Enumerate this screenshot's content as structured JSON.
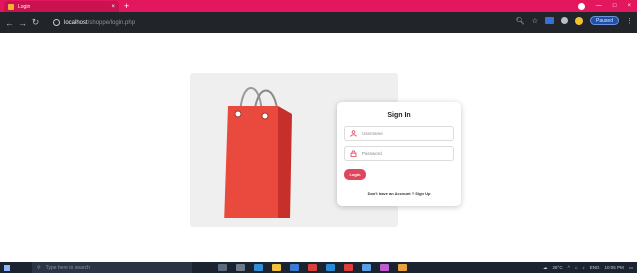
{
  "browser": {
    "tab_title": "Login",
    "tab_close": "×",
    "new_tab": "+",
    "url_host": "localhost",
    "url_path": "/shoppe/login.php",
    "profile_label": "Paused",
    "window_buttons": [
      "—",
      "□",
      "×"
    ]
  },
  "form": {
    "title": "Sign In",
    "username_placeholder": "Username",
    "password_placeholder": "Password",
    "login_button": "Login",
    "signup_prompt": "Don't have an Account ?",
    "signup_link": "Sign Up"
  },
  "taskbar": {
    "search_placeholder": "Type here to search",
    "weather": "26°C",
    "lang": "ENG",
    "time": "10:05 PM"
  },
  "colors": {
    "accent": "#e0475f",
    "tabstrip": "#e3175e",
    "bag": "#e9473c"
  }
}
